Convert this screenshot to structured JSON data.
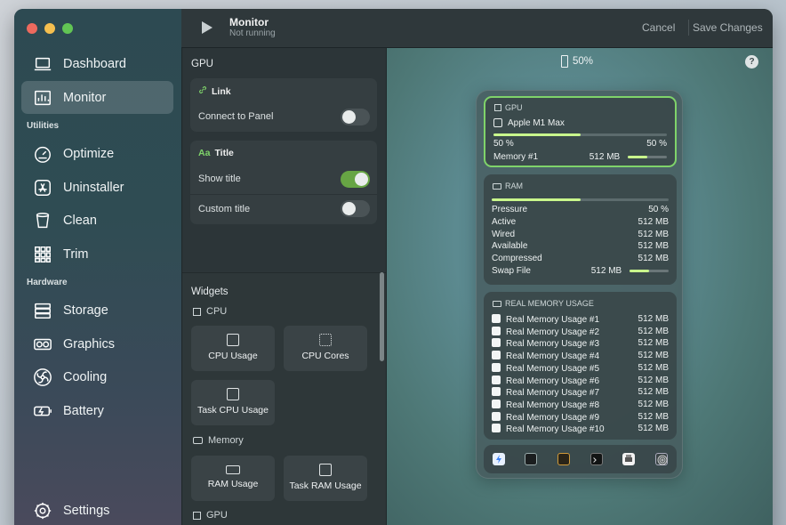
{
  "sidebar": {
    "items": [
      {
        "label": "Dashboard",
        "icon": "laptop-icon"
      },
      {
        "label": "Monitor",
        "icon": "chart-icon"
      },
      {
        "label": "Optimize",
        "icon": "gauge-icon"
      },
      {
        "label": "Uninstaller",
        "icon": "app-store-icon"
      },
      {
        "label": "Clean",
        "icon": "trash-icon"
      },
      {
        "label": "Trim",
        "icon": "grid-icon"
      },
      {
        "label": "Storage",
        "icon": "storage-icon"
      },
      {
        "label": "Graphics",
        "icon": "gpu-icon"
      },
      {
        "label": "Cooling",
        "icon": "fan-icon"
      },
      {
        "label": "Battery",
        "icon": "battery-icon"
      }
    ],
    "sections": [
      "Utilities",
      "Hardware"
    ],
    "settings_label": "Settings"
  },
  "toolbar": {
    "title": "Monitor",
    "subtitle": "Not running",
    "cancel_label": "Cancel",
    "save_label": "Save Changes"
  },
  "config": {
    "heading": "GPU",
    "link_card": {
      "title": "Link",
      "row_label": "Connect to Panel",
      "toggle_on": false
    },
    "title_card": {
      "title": "Title",
      "title_icon": "Aa",
      "rows": [
        {
          "label": "Show title",
          "toggle_on": true
        },
        {
          "label": "Custom title",
          "toggle_on": false
        }
      ]
    },
    "widgets_heading": "Widgets",
    "groups": {
      "cpu": "CPU",
      "memory": "Memory",
      "gpu": "GPU"
    },
    "buttons": {
      "cpu_usage": "CPU Usage",
      "cpu_cores": "CPU Cores",
      "task_cpu": "Task CPU Usage",
      "ram_usage": "RAM Usage",
      "task_ram": "Task RAM Usage"
    }
  },
  "preview": {
    "zoom": "50%",
    "help": "?",
    "gpu_card": {
      "heading": "GPU",
      "name": "Apple M1 Max",
      "left_pct": "50 %",
      "right_pct": "50 %",
      "memory_label": "Memory #1",
      "memory_value": "512 MB",
      "bar_fraction": 0.5,
      "memory_bar_fraction": 0.5
    },
    "ram_card": {
      "heading": "RAM",
      "bar_fraction": 0.5,
      "rows": [
        {
          "label": "Pressure",
          "value": "50 %"
        },
        {
          "label": "Active",
          "value": "512 MB"
        },
        {
          "label": "Wired",
          "value": "512 MB"
        },
        {
          "label": "Available",
          "value": "512 MB"
        },
        {
          "label": "Compressed",
          "value": "512 MB"
        },
        {
          "label": "Swap File",
          "value": "512 MB"
        }
      ],
      "swap_bar_fraction": 0.5
    },
    "real_memory_card": {
      "heading": "REAL MEMORY USAGE",
      "rows": [
        {
          "label": "Real Memory Usage #1",
          "value": "512 MB"
        },
        {
          "label": "Real Memory Usage #2",
          "value": "512 MB"
        },
        {
          "label": "Real Memory Usage #3",
          "value": "512 MB"
        },
        {
          "label": "Real Memory Usage #4",
          "value": "512 MB"
        },
        {
          "label": "Real Memory Usage #5",
          "value": "512 MB"
        },
        {
          "label": "Real Memory Usage #6",
          "value": "512 MB"
        },
        {
          "label": "Real Memory Usage #7",
          "value": "512 MB"
        },
        {
          "label": "Real Memory Usage #8",
          "value": "512 MB"
        },
        {
          "label": "Real Memory Usage #9",
          "value": "512 MB"
        },
        {
          "label": "Real Memory Usage #10",
          "value": "512 MB"
        }
      ]
    },
    "dock_icons": [
      "lightning-icon",
      "cpu-chip-icon",
      "ram-chip-icon",
      "terminal-icon",
      "printer-icon",
      "fingerprint-icon"
    ]
  },
  "colors": {
    "accent_green": "#7fd36a",
    "bar_fill": "#c9f78c",
    "toggle_on": "#67a544"
  }
}
